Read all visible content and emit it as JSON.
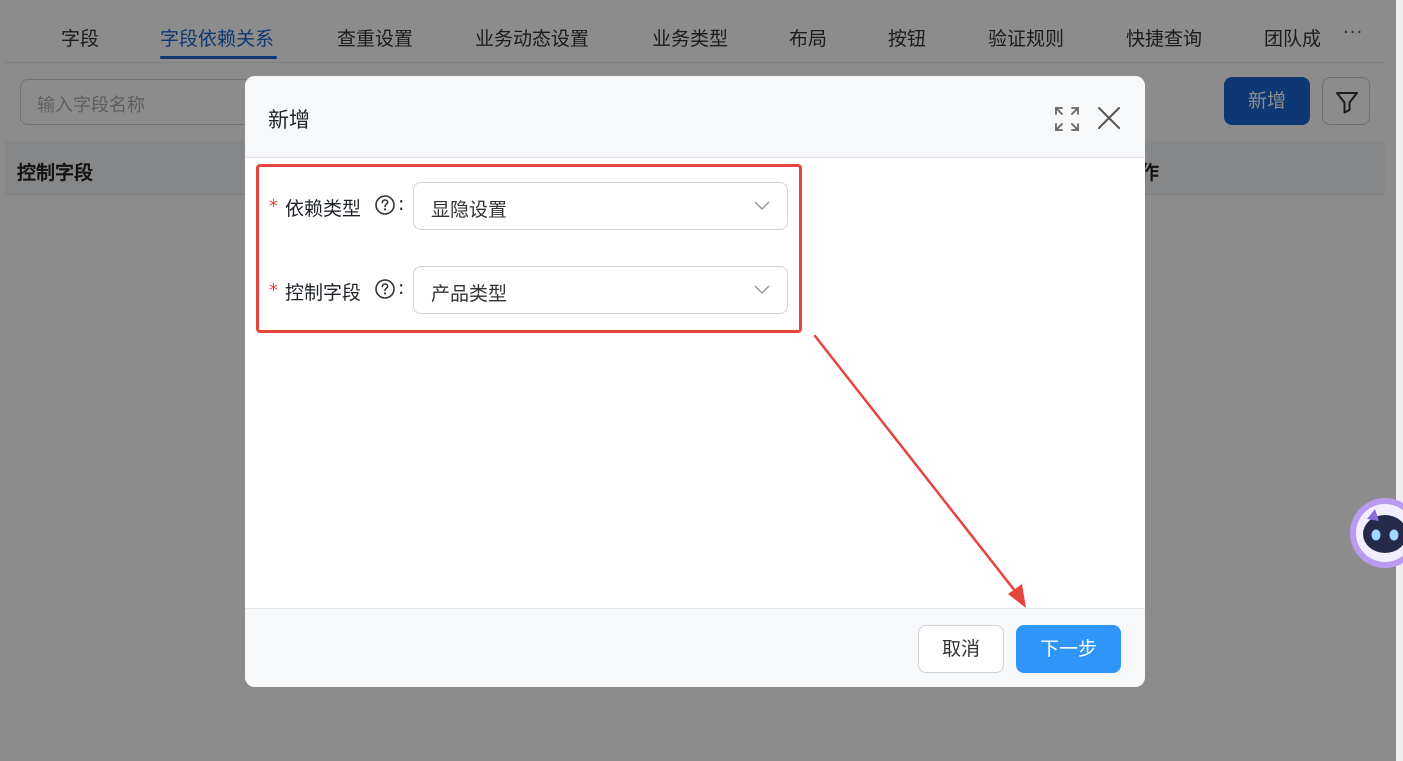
{
  "tabs": [
    {
      "label": "字段"
    },
    {
      "label": "字段依赖关系",
      "active": true
    },
    {
      "label": "查重设置"
    },
    {
      "label": "业务动态设置"
    },
    {
      "label": "业务类型"
    },
    {
      "label": "布局"
    },
    {
      "label": "按钮"
    },
    {
      "label": "验证规则"
    },
    {
      "label": "快捷查询"
    },
    {
      "label": "团队成"
    }
  ],
  "tab_more": "···",
  "toolbar": {
    "search_placeholder": "输入字段名称",
    "add_label": "新增",
    "filter_icon": "filter-icon"
  },
  "table": {
    "headers": [
      "控制字段",
      "作"
    ]
  },
  "modal": {
    "title": "新增",
    "fields": [
      {
        "label": "依赖类型",
        "value": "显隐设置",
        "required": true
      },
      {
        "label": "控制字段",
        "value": "产品类型",
        "required": true
      }
    ],
    "colon": ":",
    "required_mark": "*",
    "cancel_label": "取消",
    "next_label": "下一步"
  },
  "colors": {
    "primary": "#1966d2",
    "next_button": "#2e96f8",
    "annotation": "#e5453d"
  }
}
